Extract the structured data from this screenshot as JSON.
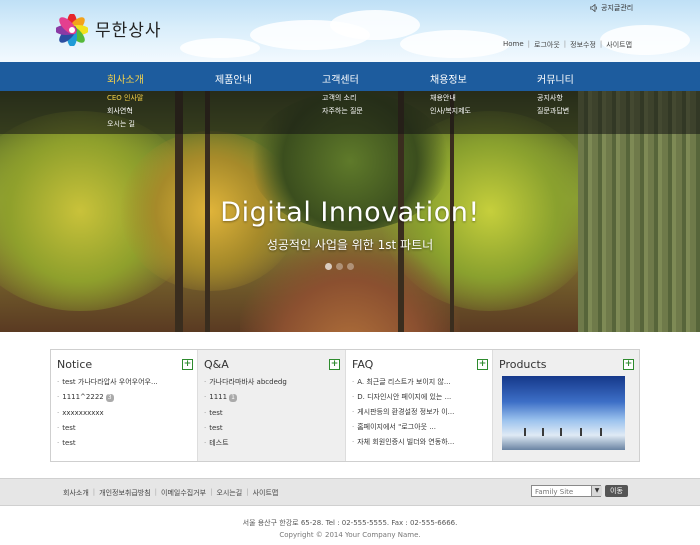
{
  "header": {
    "brand": "무한상사",
    "admin_link": "공지글관리",
    "top_links": [
      "Home",
      "로그아웃",
      "정보수정",
      "사이트맵"
    ]
  },
  "nav": {
    "items": [
      {
        "label": "회사소개",
        "active": true,
        "sub": [
          "CEO 인사말",
          "회사연혁",
          "오시는 길"
        ]
      },
      {
        "label": "제품안내",
        "active": false,
        "sub": []
      },
      {
        "label": "고객센터",
        "active": false,
        "sub": [
          "고객의 소리",
          "자주하는 질문"
        ]
      },
      {
        "label": "채용정보",
        "active": false,
        "sub": [
          "채용안내",
          "인사/복지제도"
        ]
      },
      {
        "label": "커뮤니티",
        "active": false,
        "sub": [
          "공지사항",
          "질문과답변"
        ]
      }
    ]
  },
  "hero": {
    "title": "Digital Innovation!",
    "subtitle": "성공적인 사업을 위한 1st 파트너"
  },
  "panels": {
    "notice": {
      "title": "Notice",
      "items": [
        {
          "text": "test 가나다라압사 우어우어우...",
          "badge": ""
        },
        {
          "text": "1111^2222",
          "badge": "3"
        },
        {
          "text": "xxxxxxxxxx",
          "badge": ""
        },
        {
          "text": "test",
          "badge": ""
        },
        {
          "text": "test",
          "badge": ""
        }
      ]
    },
    "qna": {
      "title": "Q&A",
      "items": [
        {
          "text": "가나다라마바사 abcdedg",
          "badge": ""
        },
        {
          "text": "1111",
          "badge": "1"
        },
        {
          "text": "test",
          "badge": ""
        },
        {
          "text": "test",
          "badge": ""
        },
        {
          "text": "테스트",
          "badge": ""
        }
      ]
    },
    "faq": {
      "title": "FAQ",
      "items": [
        {
          "text": "A. 최근글 리스트가 보이지 않...",
          "badge": ""
        },
        {
          "text": "D. 디자인시안 페이지에 있는 ...",
          "badge": ""
        },
        {
          "text": "게시판등의 환경설정 정보가 이...",
          "badge": ""
        },
        {
          "text": "홈페이지에서 \"로그아웃 ...",
          "badge": ""
        },
        {
          "text": "자체 회원인증시 빌더와 연동하...",
          "badge": ""
        }
      ]
    },
    "products": {
      "title": "Products"
    },
    "more_symbol": "+"
  },
  "footer": {
    "links": [
      "회사소개",
      "개인정보취급방침",
      "이메일수집거부",
      "오시는길",
      "사이트맵"
    ],
    "family_select": "Family Site",
    "family_arrow": "▼",
    "go_label": "이동",
    "address": "서울 용산구 한강로 65-28. Tel : 02-555-5555.  Fax : 02-555-6666.",
    "copyright": "Copyright © 2014 Your Company Name."
  },
  "colors": {
    "nav_bg": "#1d5c9e",
    "nav_active": "#f7d34a",
    "plus_green": "#2e8b2e"
  }
}
